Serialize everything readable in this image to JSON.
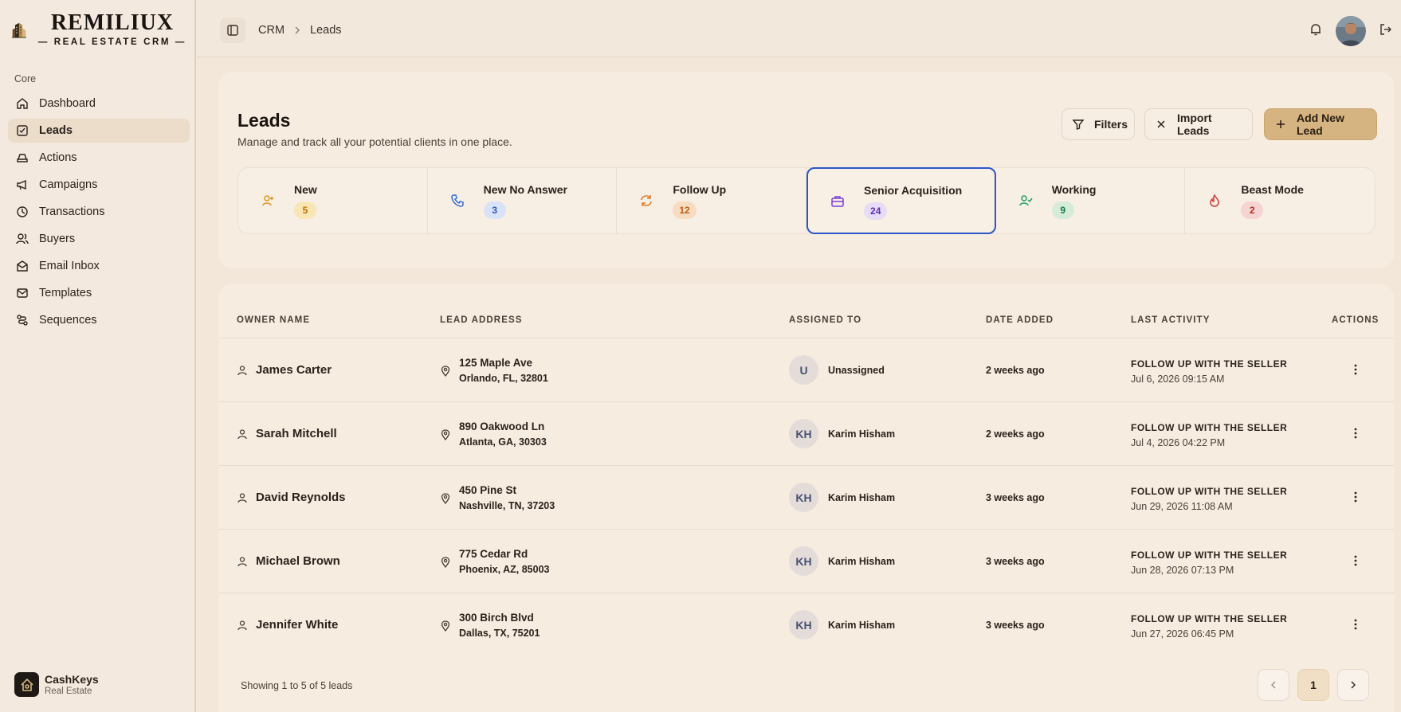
{
  "brand": {
    "title": "REMILIUX",
    "subtitle": "— REAL ESTATE CRM —"
  },
  "sidebar": {
    "section": "Core",
    "items": [
      {
        "label": "Dashboard",
        "icon": "home-icon"
      },
      {
        "label": "Leads",
        "icon": "leads-icon",
        "active": true
      },
      {
        "label": "Actions",
        "icon": "actions-icon"
      },
      {
        "label": "Campaigns",
        "icon": "megaphone-icon"
      },
      {
        "label": "Transactions",
        "icon": "clock-icon"
      },
      {
        "label": "Buyers",
        "icon": "users-icon"
      },
      {
        "label": "Email Inbox",
        "icon": "inbox-icon"
      },
      {
        "label": "Templates",
        "icon": "mail-icon"
      },
      {
        "label": "Sequences",
        "icon": "route-icon"
      }
    ],
    "org": {
      "name": "CashKeys",
      "sub": "Real Estate"
    }
  },
  "header": {
    "breadcrumb": [
      "CRM",
      "Leads"
    ]
  },
  "page": {
    "title": "Leads",
    "subtitle": "Manage and track all your potential clients in one place.",
    "buttons": {
      "filters": "Filters",
      "import": "Import Leads",
      "add": "Add New Lead"
    }
  },
  "statuses": [
    {
      "name": "New",
      "count": "5",
      "color": "#e0961d",
      "badge_bg": "#f9e6b5",
      "badge_fg": "#b8700c"
    },
    {
      "name": "New No Answer",
      "count": "3",
      "color": "#3a6ad6",
      "badge_bg": "#d9e3f7",
      "badge_fg": "#2e56b5"
    },
    {
      "name": "Follow Up",
      "count": "12",
      "color": "#e07a24",
      "badge_bg": "#f8dcc1",
      "badge_fg": "#bf5c15"
    },
    {
      "name": "Senior Acquisition",
      "count": "24",
      "color": "#7b3fd3",
      "badge_bg": "#e6dcf6",
      "badge_fg": "#5e2fb0",
      "selected": true
    },
    {
      "name": "Working",
      "count": "9",
      "color": "#1f9d5c",
      "badge_bg": "#d5ecdb",
      "badge_fg": "#157a43"
    },
    {
      "name": "Beast Mode",
      "count": "2",
      "color": "#d23a32",
      "badge_bg": "#f6d4d1",
      "badge_fg": "#b52a24"
    }
  ],
  "table": {
    "columns": [
      "OWNER NAME",
      "LEAD ADDRESS",
      "ASSIGNED TO",
      "DATE ADDED",
      "LAST ACTIVITY",
      "ACTIONS"
    ],
    "rows": [
      {
        "owner": "James Carter",
        "addr1": "125 Maple Ave",
        "addr2": "Orlando, FL, 32801",
        "initials": "U",
        "assigned": "Unassigned",
        "date": "2 weeks ago",
        "activity": "FOLLOW UP WITH THE SELLER",
        "activity_time": "Jul 6, 2026 09:15 AM"
      },
      {
        "owner": "Sarah Mitchell",
        "addr1": "890 Oakwood Ln",
        "addr2": "Atlanta, GA, 30303",
        "initials": "KH",
        "assigned": "Karim Hisham",
        "date": "2 weeks ago",
        "activity": "FOLLOW UP WITH THE SELLER",
        "activity_time": "Jul 4, 2026 04:22 PM"
      },
      {
        "owner": "David Reynolds",
        "addr1": "450 Pine St",
        "addr2": "Nashville, TN, 37203",
        "initials": "KH",
        "assigned": "Karim Hisham",
        "date": "3 weeks ago",
        "activity": "FOLLOW UP WITH THE SELLER",
        "activity_time": "Jun 29, 2026 11:08 AM"
      },
      {
        "owner": "Michael Brown",
        "addr1": "775 Cedar Rd",
        "addr2": "Phoenix, AZ, 85003",
        "initials": "KH",
        "assigned": "Karim Hisham",
        "date": "3 weeks ago",
        "activity": "FOLLOW UP WITH THE SELLER",
        "activity_time": "Jun 28, 2026 07:13 PM"
      },
      {
        "owner": "Jennifer White",
        "addr1": "300 Birch Blvd",
        "addr2": "Dallas, TX, 75201",
        "initials": "KH",
        "assigned": "Karim Hisham",
        "date": "3 weeks ago",
        "activity": "FOLLOW UP WITH THE SELLER",
        "activity_time": "Jun 27, 2026 06:45 PM"
      }
    ],
    "footer": "Showing 1 to 5 of 5 leads",
    "current_page": "1"
  }
}
